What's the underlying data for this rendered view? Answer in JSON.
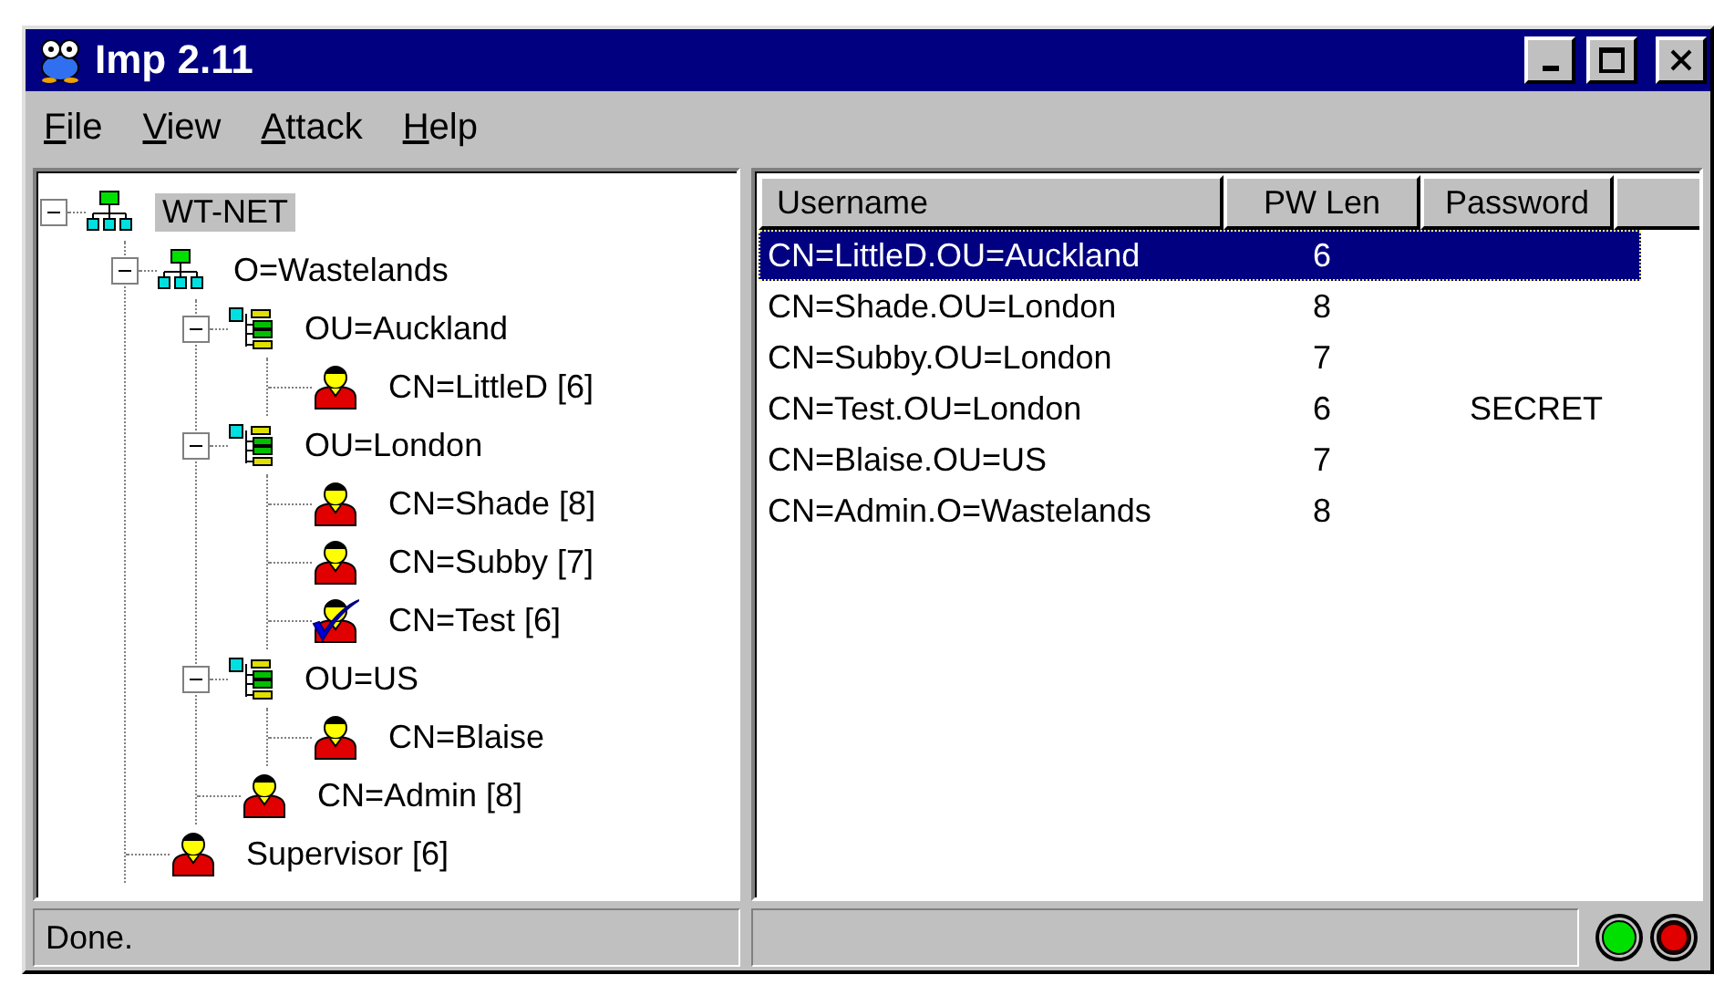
{
  "window": {
    "title": "Imp 2.11"
  },
  "menu": [
    {
      "label": "File"
    },
    {
      "label": "View"
    },
    {
      "label": "Attack"
    },
    {
      "label": "Help"
    }
  ],
  "tree": [
    {
      "label": "WT-NET",
      "kind": "network",
      "selected": true,
      "expanded": true,
      "children": [
        {
          "label": "O=Wastelands",
          "kind": "network",
          "selected": false,
          "expanded": true,
          "children": [
            {
              "label": "OU=Auckland",
              "kind": "ou",
              "selected": false,
              "expanded": true,
              "children": [
                {
                  "label": "CN=LittleD [6]",
                  "kind": "user",
                  "selected": false,
                  "cracked": false
                }
              ]
            },
            {
              "label": "OU=London",
              "kind": "ou",
              "selected": false,
              "expanded": true,
              "children": [
                {
                  "label": "CN=Shade [8]",
                  "kind": "user",
                  "selected": false,
                  "cracked": false
                },
                {
                  "label": "CN=Subby [7]",
                  "kind": "user",
                  "selected": false,
                  "cracked": false
                },
                {
                  "label": "CN=Test [6]",
                  "kind": "user",
                  "selected": false,
                  "cracked": true
                }
              ]
            },
            {
              "label": "OU=US",
              "kind": "ou",
              "selected": false,
              "expanded": true,
              "children": [
                {
                  "label": "CN=Blaise",
                  "kind": "user",
                  "selected": false,
                  "cracked": false
                }
              ]
            },
            {
              "label": "CN=Admin [8]",
              "kind": "user",
              "selected": false,
              "cracked": false
            }
          ]
        },
        {
          "label": "Supervisor [6]",
          "kind": "user",
          "selected": false,
          "cracked": false
        }
      ]
    }
  ],
  "table": {
    "columns": [
      "Username",
      "PW Len",
      "Password"
    ],
    "rows": [
      {
        "username": "CN=LittleD.OU=Auckland",
        "pw_len": "6",
        "password": null,
        "selected": true
      },
      {
        "username": "CN=Shade.OU=London",
        "pw_len": "8",
        "password": null,
        "selected": false
      },
      {
        "username": "CN=Subby.OU=London",
        "pw_len": "7",
        "password": null,
        "selected": false
      },
      {
        "username": "CN=Test.OU=London",
        "pw_len": "6",
        "password": "SECRET",
        "selected": false
      },
      {
        "username": "CN=Blaise.OU=US",
        "pw_len": "7",
        "password": null,
        "selected": false
      },
      {
        "username": "CN=Admin.O=Wastelands",
        "pw_len": "8",
        "password": null,
        "selected": false
      }
    ]
  },
  "status_bar": {
    "message": "Done.",
    "lights": [
      {
        "on": true,
        "color": "#00e000"
      },
      {
        "on": false,
        "color": "#e00000"
      }
    ]
  }
}
